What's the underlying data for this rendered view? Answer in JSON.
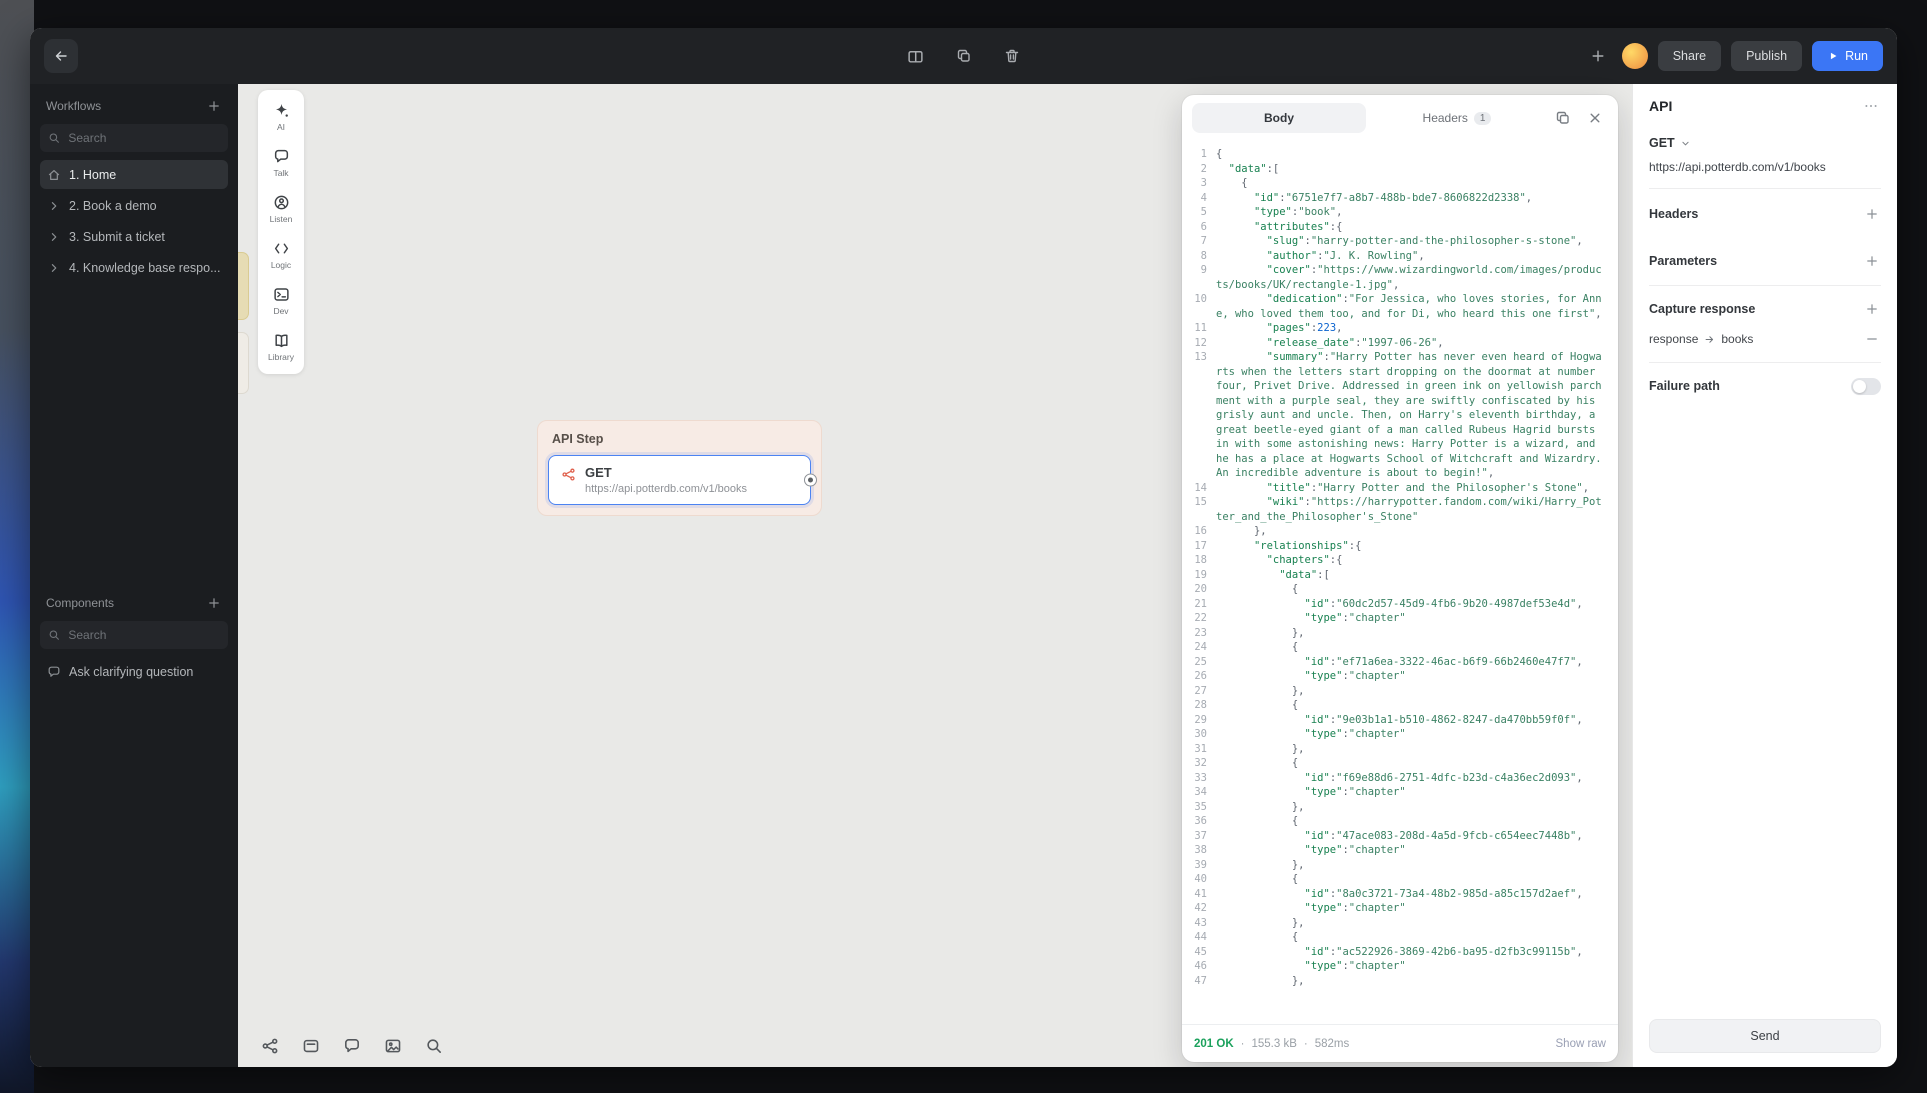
{
  "topbar": {
    "share_label": "Share",
    "publish_label": "Publish",
    "run_label": "Run"
  },
  "sidebar": {
    "workflows_title": "Workflows",
    "search_placeholder": "Search",
    "items": [
      {
        "label": "1. Home",
        "icon": "home",
        "selected": true
      },
      {
        "label": "2. Book a demo",
        "icon": "chevron"
      },
      {
        "label": "3. Submit a ticket",
        "icon": "chevron"
      },
      {
        "label": "4. Knowledge base respo...",
        "icon": "chevron"
      }
    ],
    "components_title": "Components",
    "components_search_placeholder": "Search",
    "ask_label": "Ask clarifying question"
  },
  "palette": {
    "items": [
      {
        "label": "AI",
        "icon": "sparkle"
      },
      {
        "label": "Talk",
        "icon": "chat"
      },
      {
        "label": "Listen",
        "icon": "person"
      },
      {
        "label": "Logic",
        "icon": "brackets"
      },
      {
        "label": "Dev",
        "icon": "terminal"
      },
      {
        "label": "Library",
        "icon": "book"
      }
    ]
  },
  "canvas": {
    "api_step": {
      "title": "API Step",
      "method": "GET",
      "url": "https://api.potterdb.com/v1/books"
    }
  },
  "response_panel": {
    "body_tab": "Body",
    "headers_tab": "Headers",
    "headers_badge": "1",
    "status": "201 OK",
    "sep": "·",
    "size": "155.3 kB",
    "time": "582ms",
    "show_raw": "Show raw",
    "code_lines": [
      "{",
      "  \"data\":[",
      "    {",
      "      \"id\":\"6751e7f7-a8b7-488b-bde7-8606822d2338\",",
      "      \"type\":\"book\",",
      "      \"attributes\":{",
      "        \"slug\":\"harry-potter-and-the-philosopher-s-stone\",",
      "        \"author\":\"J. K. Rowling\",",
      "        \"cover\":\"https://www.wizardingworld.com/images/products/books/UK/rectangle-1.jpg\",",
      "        \"dedication\":\"For Jessica, who loves stories, for Anne, who loved them too, and for Di, who heard this one first\",",
      "        \"pages\":223,",
      "        \"release_date\":\"1997-06-26\",",
      "        \"summary\":\"Harry Potter has never even heard of Hogwarts when the letters start dropping on the doormat at number four, Privet Drive. Addressed in green ink on yellowish parchment with a purple seal, they are swiftly confiscated by his grisly aunt and uncle. Then, on Harry's eleventh birthday, a great beetle-eyed giant of a man called Rubeus Hagrid bursts in with some astonishing news: Harry Potter is a wizard, and he has a place at Hogwarts School of Witchcraft and Wizardry. An incredible adventure is about to begin!\",",
      "        \"title\":\"Harry Potter and the Philosopher's Stone\",",
      "        \"wiki\":\"https://harrypotter.fandom.com/wiki/Harry_Potter_and_the_Philosopher's_Stone\"",
      "      },",
      "      \"relationships\":{",
      "        \"chapters\":{",
      "          \"data\":[",
      "            {",
      "              \"id\":\"60dc2d57-45d9-4fb6-9b20-4987def53e4d\",",
      "              \"type\":\"chapter\"",
      "            },",
      "            {",
      "              \"id\":\"ef71a6ea-3322-46ac-b6f9-66b2460e47f7\",",
      "              \"type\":\"chapter\"",
      "            },",
      "            {",
      "              \"id\":\"9e03b1a1-b510-4862-8247-da470bb59f0f\",",
      "              \"type\":\"chapter\"",
      "            },",
      "            {",
      "              \"id\":\"f69e88d6-2751-4dfc-b23d-c4a36ec2d093\",",
      "              \"type\":\"chapter\"",
      "            },",
      "            {",
      "              \"id\":\"47ace083-208d-4a5d-9fcb-c654eec7448b\",",
      "              \"type\":\"chapter\"",
      "            },",
      "            {",
      "              \"id\":\"8a0c3721-73a4-48b2-985d-a85c157d2aef\",",
      "              \"type\":\"chapter\"",
      "            },",
      "            {",
      "              \"id\":\"ac522926-3869-42b6-ba95-d2fb3c99115b\",",
      "              \"type\":\"chapter\"",
      "            },"
    ]
  },
  "inspector": {
    "title": "API",
    "method": "GET",
    "url": "https://api.potterdb.com/v1/books",
    "headers_label": "Headers",
    "parameters_label": "Parameters",
    "capture_label": "Capture response",
    "capture_from": "response",
    "capture_to": "books",
    "failure_label": "Failure path",
    "send_label": "Send"
  },
  "colors": {
    "accent_blue": "#3b76f5",
    "success_green": "#1ba15c",
    "node_red": "#e0614d",
    "step_card_pink": "#f7ebe5"
  }
}
